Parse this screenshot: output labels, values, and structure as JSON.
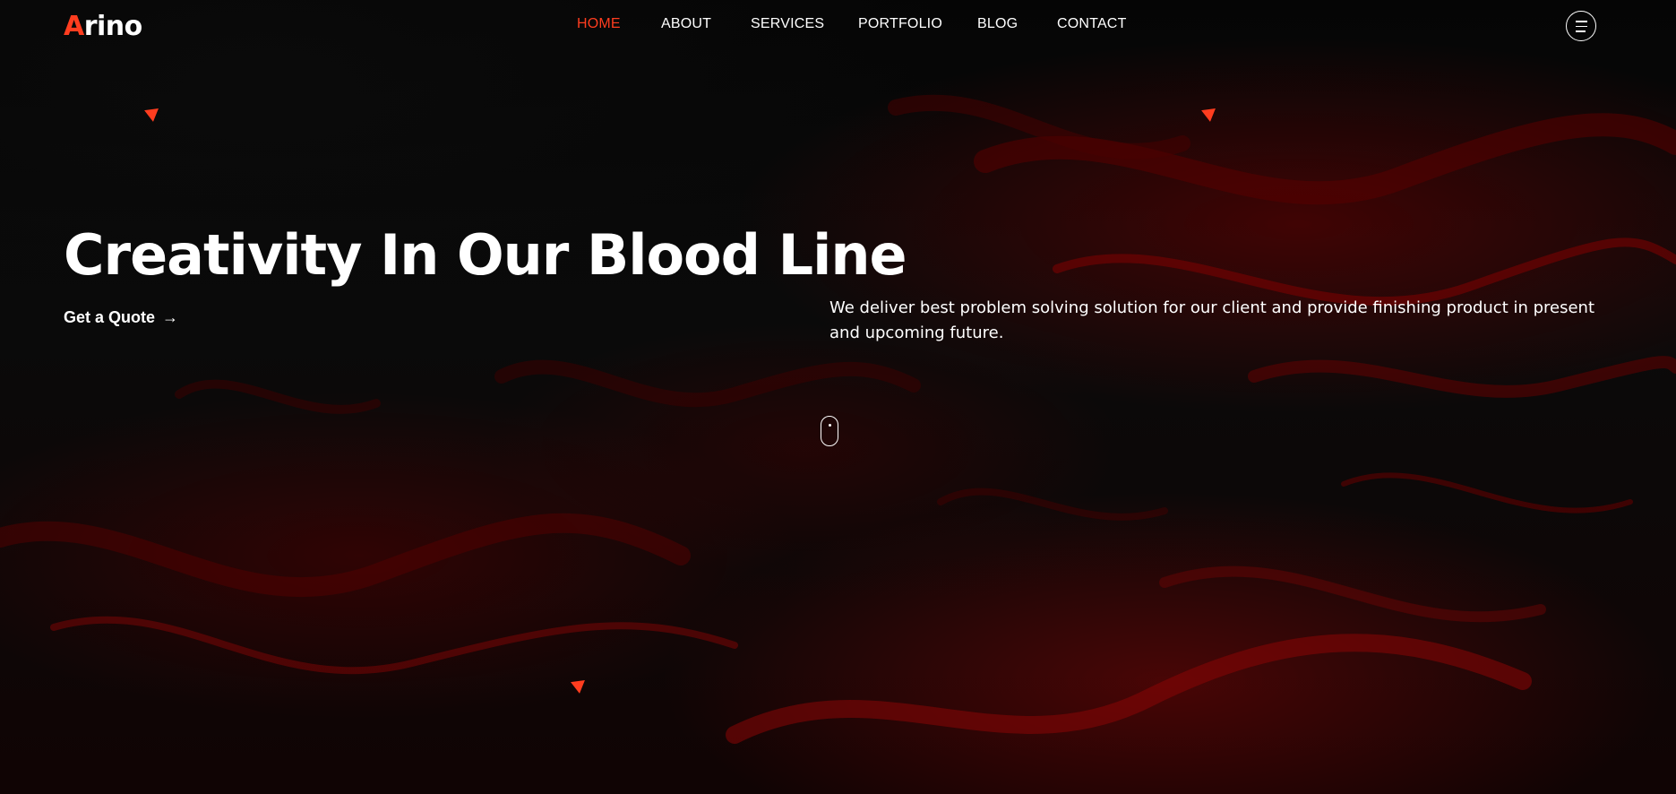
{
  "brand": {
    "logo_first": "A",
    "logo_rest": "rino",
    "accent_color": "#ff3d1f"
  },
  "nav": {
    "items": [
      {
        "label": "HOME",
        "active": true
      },
      {
        "label": "ABOUT",
        "active": false
      },
      {
        "label": "SERVICES",
        "active": false
      },
      {
        "label": "PORTFOLIO",
        "active": false
      },
      {
        "label": "BLOG",
        "active": false
      },
      {
        "label": "CONTACT",
        "active": false
      }
    ],
    "menu_icon": "hamburger-menu-icon"
  },
  "hero": {
    "title": "Creativity In Our Blood Line",
    "cta_label": "Get a Quote",
    "cta_arrow": "→",
    "description": "We deliver best problem solving solution for our client and provide finishing product in present and upcoming future.",
    "scroll_icon": "mouse-scroll-icon",
    "decor_icon": "triangle-icon"
  }
}
